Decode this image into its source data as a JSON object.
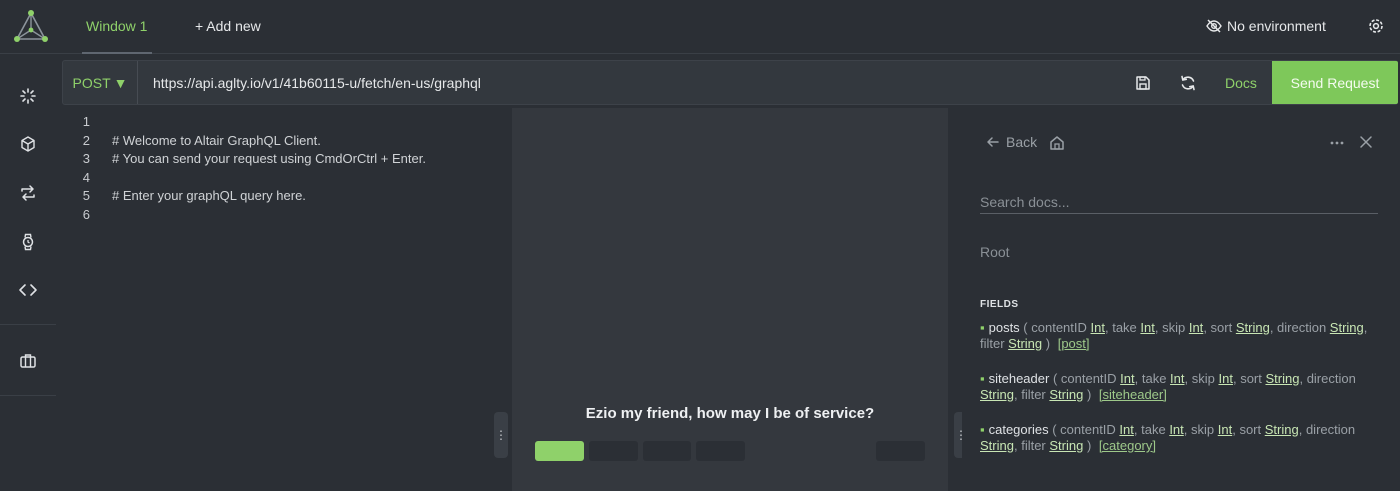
{
  "header": {
    "tab_label": "Window 1",
    "add_new_label": "+ Add new",
    "environment_label": "No environment"
  },
  "request": {
    "method": "POST",
    "url": "https://api.aglty.io/v1/41b60115-u/fetch/en-us/graphql",
    "docs_label": "Docs",
    "send_label": "Send Request"
  },
  "editor": {
    "lines": [
      {
        "num": "1",
        "text": ""
      },
      {
        "num": "2",
        "text": "# Welcome to Altair GraphQL Client."
      },
      {
        "num": "3",
        "text": "# You can send your request using CmdOrCtrl + Enter."
      },
      {
        "num": "4",
        "text": ""
      },
      {
        "num": "5",
        "text": "# Enter your graphQL query here."
      },
      {
        "num": "6",
        "text": ""
      }
    ]
  },
  "result": {
    "message": "Ezio my friend, how may I be of service?"
  },
  "docs": {
    "back_label": "Back",
    "search_placeholder": "Search docs...",
    "root_label": "Root",
    "fields_title": "FIELDS",
    "fields": [
      {
        "name": "posts",
        "args": [
          {
            "name": "contentID",
            "type": "Int"
          },
          {
            "name": "take",
            "type": "Int"
          },
          {
            "name": "skip",
            "type": "Int"
          },
          {
            "name": "sort",
            "type": "String"
          },
          {
            "name": "direction",
            "type": "String"
          },
          {
            "name": "filter",
            "type": "String"
          }
        ],
        "return_type": "[post]"
      },
      {
        "name": "siteheader",
        "args": [
          {
            "name": "contentID",
            "type": "Int"
          },
          {
            "name": "take",
            "type": "Int"
          },
          {
            "name": "skip",
            "type": "Int"
          },
          {
            "name": "sort",
            "type": "String"
          },
          {
            "name": "direction",
            "type": "String"
          },
          {
            "name": "filter",
            "type": "String"
          }
        ],
        "return_type": "[siteheader]"
      },
      {
        "name": "categories",
        "args": [
          {
            "name": "contentID",
            "type": "Int"
          },
          {
            "name": "take",
            "type": "Int"
          },
          {
            "name": "skip",
            "type": "Int"
          },
          {
            "name": "sort",
            "type": "String"
          },
          {
            "name": "direction",
            "type": "String"
          },
          {
            "name": "filter",
            "type": "String"
          }
        ],
        "return_type": "[category]"
      }
    ]
  },
  "colors": {
    "accent": "#8fd16a",
    "send_button": "#7ec85a",
    "background": "#2b2f35",
    "panel": "#34383e"
  },
  "icons": {
    "sidebar": [
      "loader-icon",
      "cube-icon",
      "swap-icon",
      "watch-icon",
      "code-icon",
      "briefcase-icon"
    ]
  }
}
